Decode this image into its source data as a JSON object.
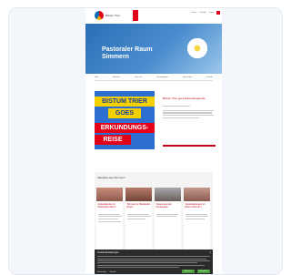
{
  "header": {
    "logo_text": "Bistum Trier",
    "top_nav": [
      "Home",
      "Kontakt",
      "Suche"
    ]
  },
  "hero": {
    "title_line1": "Pastoraler Raum",
    "title_line2": "Simmern"
  },
  "main_nav": [
    "Start",
    "Aktuelles",
    "Über uns",
    "Gottesdienste",
    "Gemeinden",
    "Kontakt"
  ],
  "feature": {
    "image_band_1": "BISTUM TRIER",
    "image_band_2": "GOES",
    "image_band_3": "ERKUNDUNGS-",
    "image_band_4": "REISE",
    "headline": "Bistum Trier goes Erkundungsreise"
  },
  "section": {
    "title": "Aktuelles aus Simmern",
    "articles": [
      {
        "title": "Gottesdienste im Pastoralen Raum"
      },
      {
        "title": "Termine im Pastoralen Raum"
      },
      {
        "title": "Neues aus den Gemeinden"
      },
      {
        "title": "Veranstaltungen im Raum Simmern"
      }
    ]
  },
  "cookie": {
    "title": "Cookie-Einstellungen",
    "option_1": "Notwendig",
    "option_2": "Statistik",
    "accept_label": "Akzeptieren",
    "save_label": "Speichern",
    "close": "×"
  },
  "colors": {
    "brand_red": "#c4001a",
    "hero_blue": "#2a6fb5",
    "accept_green": "#4a9b3c"
  }
}
